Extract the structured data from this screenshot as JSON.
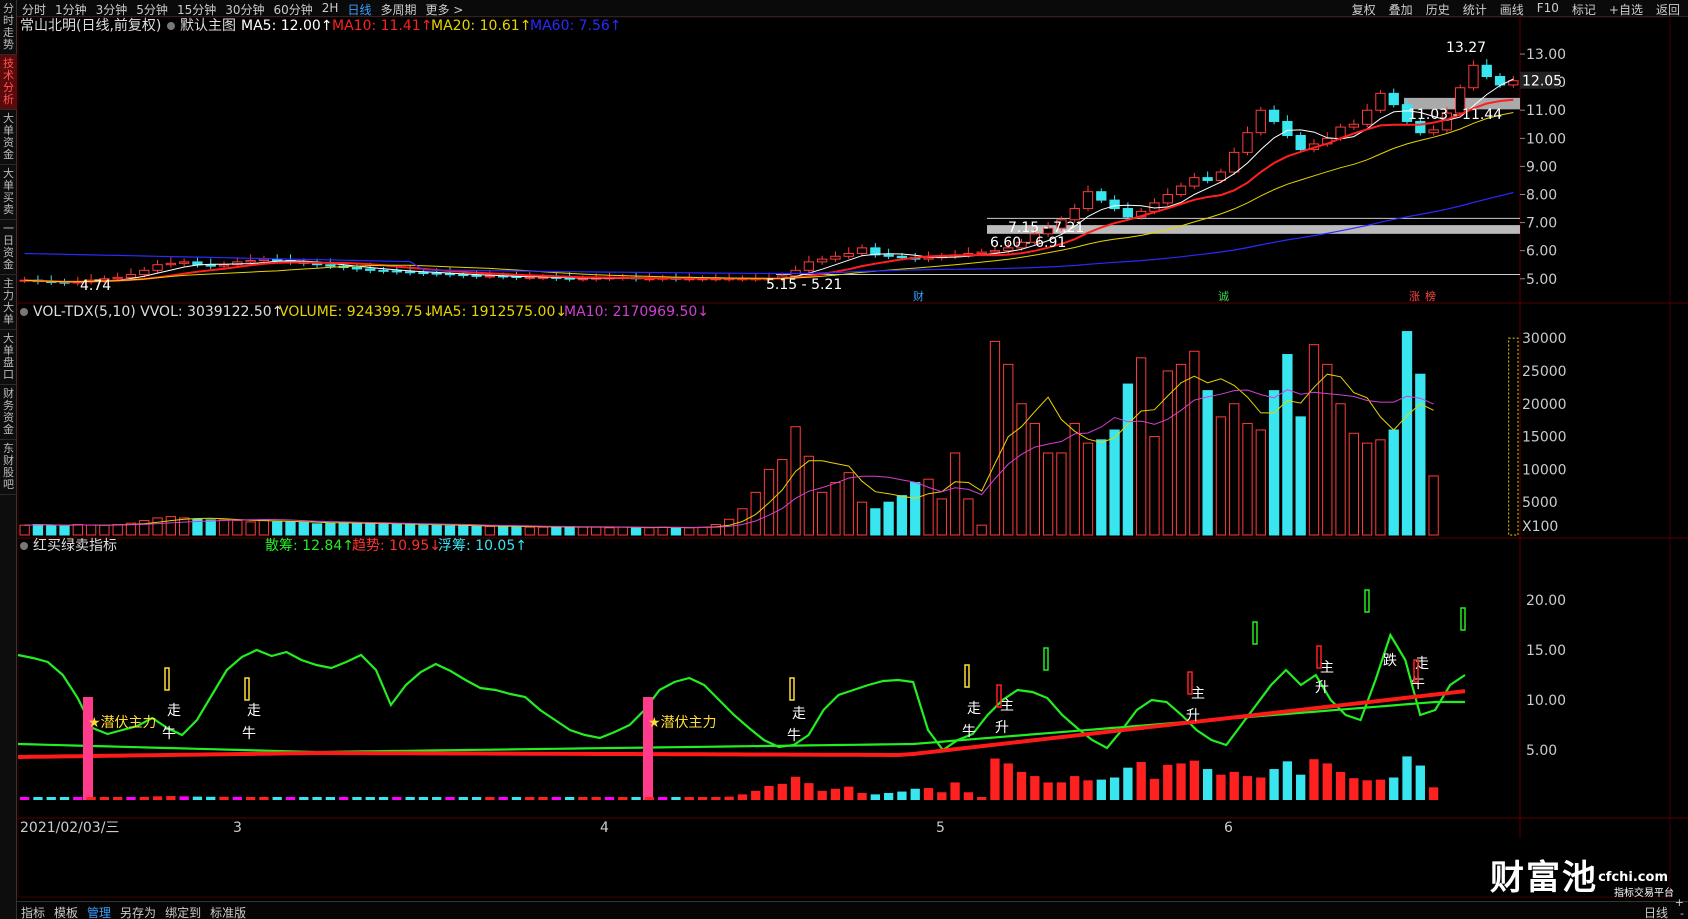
{
  "top_nav": [
    "分时",
    "1分钟",
    "3分钟",
    "5分钟",
    "15分钟",
    "30分钟",
    "60分钟",
    "2H",
    "日线",
    "多周期",
    "更多 >"
  ],
  "top_nav_active": "日线",
  "top_right": [
    "复权",
    "叠加",
    "历史",
    "统计",
    "画线",
    "F10",
    "标记",
    "+自选",
    "返回"
  ],
  "side_menu": [
    "分时走势",
    "技术分析",
    "大单资金",
    "大单买卖",
    "一日资金",
    "主力大单",
    "大单盘口",
    "财务资金",
    "东财股吧"
  ],
  "side_menu_active": "技术分析",
  "main_panel": {
    "title": "常山北明(日线,前复权)",
    "template": "默认主图",
    "ma5": "MA5: 12.00↑",
    "ma10": "MA10: 11.41↑",
    "ma20": "MA20: 10.61↑",
    "ma60": "MA60: 7.56↑",
    "y_ticks": [
      "13.00",
      "12.00",
      "11.00",
      "10.00",
      "9.00",
      "8.00",
      "7.00",
      "6.00",
      "5.00"
    ],
    "current_price": "12.05",
    "high_label": "13.27",
    "low_label": "4.74",
    "zone_labels": [
      "11.03 - 11.44",
      "7.15 - 7.21",
      "6.60 - 6.91",
      "5.15 - 5.21"
    ],
    "markers": [
      "财",
      "诚",
      "涨",
      "榜"
    ]
  },
  "vol_panel": {
    "title": "VOL-TDX(5,10) VVOL: 3039122.50↑",
    "volume": "VOLUME: 924399.75↓",
    "ma5": "MA5: 1912575.00↓",
    "ma10": "MA10: 2170969.50↓",
    "y_ticks": [
      "30000",
      "25000",
      "20000",
      "15000",
      "10000",
      "5000",
      "X100"
    ]
  },
  "ind_panel": {
    "title": "红买绿卖指标",
    "sanchou": "散筹: 12.84↑",
    "qushi": "趋势: 10.95↓",
    "fuchou": "浮筹: 10.05↑",
    "y_ticks": [
      "20.00",
      "15.00",
      "10.00",
      "5.00"
    ],
    "labels": [
      "潜伏主力",
      "潜伏主力",
      "走",
      "牛",
      "走",
      "牛",
      "走",
      "牛",
      "走",
      "牛",
      "主",
      "升",
      "主",
      "升",
      "主",
      "升",
      "跌",
      "走",
      "牛",
      "主",
      "升"
    ]
  },
  "x_axis": {
    "date": "2021/02/03/三",
    "months": [
      "3",
      "4",
      "5",
      "6"
    ]
  },
  "bottom_bar": [
    "指标",
    "模板",
    "管理",
    "另存为",
    "绑定到",
    "标准版"
  ],
  "bottom_bar_active": "管理",
  "period_label": "日线",
  "watermark": {
    "main": "财富池",
    "site": "cfchi.com",
    "sub": "指标交易平台"
  },
  "colors": {
    "up": "#ff3b3b",
    "down": "#39e6f0",
    "ma5": "#ffffff",
    "ma10": "#ff2020",
    "ma20": "#e6d400",
    "ma60": "#2a2aff",
    "vol_ma5": "#e6d400",
    "vol_ma10": "#d040d0",
    "green_line": "#22ee22",
    "pink": "#ff3b8b"
  },
  "chart_data": {
    "type": "candlestick",
    "note_units": "price CNY",
    "closes": [
      4.95,
      4.9,
      4.88,
      4.85,
      4.9,
      4.95,
      5.0,
      5.05,
      5.15,
      5.3,
      5.5,
      5.55,
      5.6,
      5.5,
      5.45,
      5.5,
      5.6,
      5.65,
      5.7,
      5.65,
      5.6,
      5.55,
      5.5,
      5.45,
      5.4,
      5.35,
      5.3,
      5.28,
      5.25,
      5.22,
      5.2,
      5.18,
      5.15,
      5.12,
      5.1,
      5.1,
      5.08,
      5.05,
      5.05,
      5.05,
      5.02,
      5.0,
      5.0,
      5.02,
      5.03,
      5.05,
      5.0,
      5.0,
      5.02,
      5.0,
      5.0,
      5.0,
      5.0,
      5.0,
      5.0,
      5.0,
      5.0,
      5.1,
      5.3,
      5.6,
      5.7,
      5.8,
      5.9,
      6.1,
      5.85,
      5.8,
      5.75,
      5.7,
      5.75,
      5.8,
      5.85,
      5.9,
      5.95,
      6.0,
      6.1,
      6.3,
      6.6,
      6.8,
      7.1,
      7.5,
      8.1,
      7.8,
      7.5,
      7.2,
      7.4,
      7.7,
      8.0,
      8.3,
      8.6,
      8.5,
      8.8,
      9.5,
      10.2,
      11.0,
      10.6,
      10.1,
      9.6,
      9.8,
      10.0,
      10.4,
      10.5,
      11.0,
      11.6,
      11.2,
      10.6,
      10.2,
      10.3,
      10.9,
      11.8,
      12.6,
      12.2,
      11.9,
      12.05
    ],
    "volume_x100": [
      1500,
      1600,
      1500,
      1400,
      1600,
      1500,
      1500,
      1600,
      1800,
      2200,
      2600,
      2800,
      2600,
      2400,
      2300,
      2300,
      2200,
      2000,
      2200,
      2000,
      2000,
      1900,
      1700,
      1800,
      1900,
      1800,
      1700,
      1600,
      1700,
      1600,
      1500,
      1500,
      1400,
      1400,
      1300,
      1300,
      1300,
      1300,
      1200,
      1200,
      1200,
      1300,
      1200,
      1200,
      1100,
      1200,
      1100,
      1100,
      1200,
      1100,
      1100,
      1200,
      1600,
      2400,
      4000,
      6500,
      10000,
      11500,
      16500,
      12000,
      6500,
      8000,
      9500,
      5000,
      4000,
      5000,
      6000,
      8000,
      8500,
      5500,
      12500,
      5500,
      1500,
      29500,
      26000,
      20000,
      17000,
      12500,
      12500,
      17000,
      14000,
      14500,
      16000,
      23000,
      27000,
      15000,
      25000,
      26000,
      28000,
      22000,
      18000,
      20000,
      17000,
      16000,
      22000,
      27500,
      18000,
      29000,
      26000,
      20000,
      15500,
      14000,
      14500,
      16000,
      31000,
      24500,
      9000
    ],
    "x_axis_months": [
      "2021/02",
      "3",
      "4",
      "5",
      "6"
    ]
  }
}
